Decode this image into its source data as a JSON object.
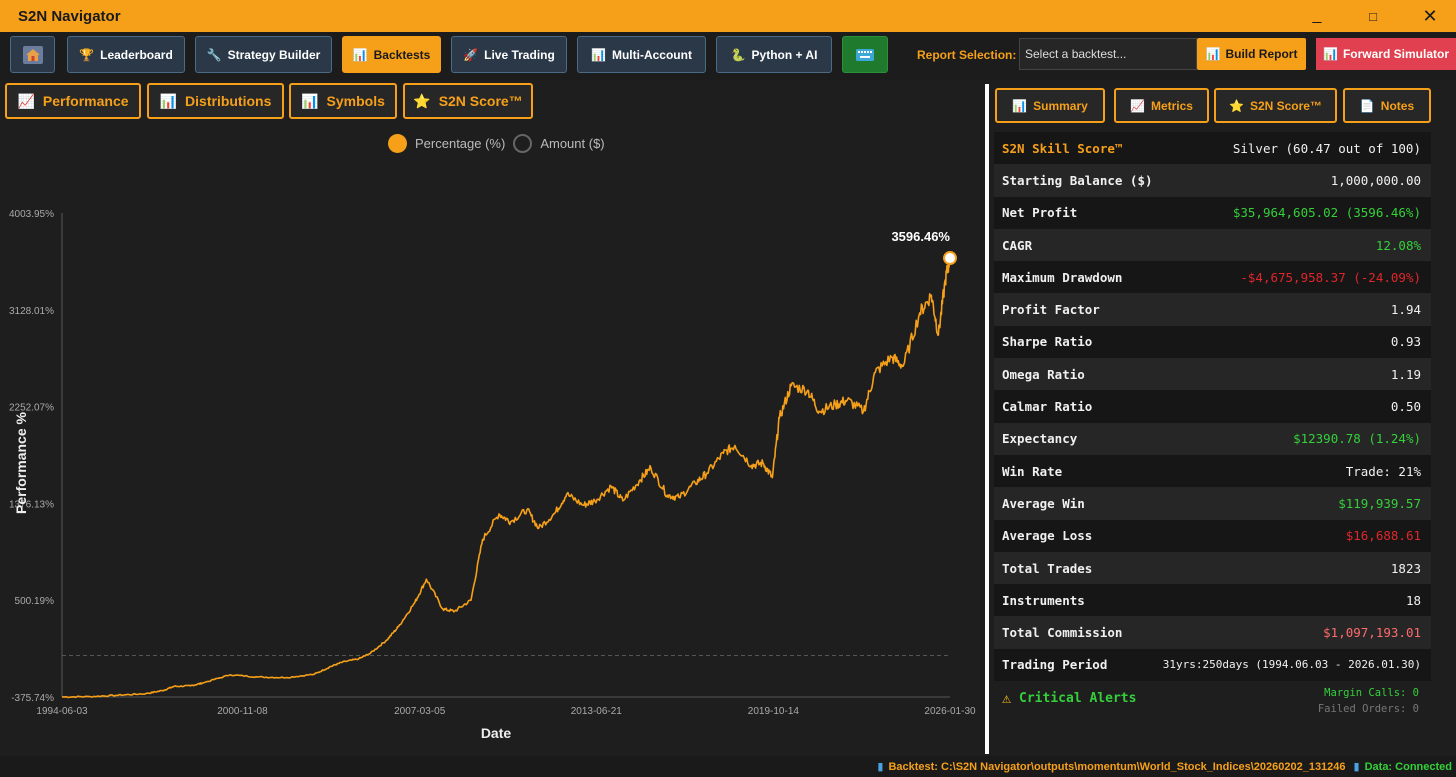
{
  "app": {
    "title": "S2N Navigator"
  },
  "window_controls": {
    "minimize": "_",
    "maximize": "□",
    "close": "✕"
  },
  "toolbar": {
    "home_icon": "home-icon",
    "buttons": [
      {
        "label": "Leaderboard",
        "icon": "🏆"
      },
      {
        "label": "Strategy Builder",
        "icon": "🔧"
      },
      {
        "label": "Backtests",
        "icon": "📊"
      },
      {
        "label": "Live Trading",
        "icon": "🚀"
      },
      {
        "label": "Multi-Account",
        "icon": "📊"
      },
      {
        "label": "Python + AI",
        "icon": "🐍"
      }
    ],
    "report_label": "Report Selection:",
    "report_placeholder": "Select a backtest...",
    "build_report": "Build Report",
    "forward_simulator": "Forward Simulator"
  },
  "left_tabs": [
    {
      "label": "Performance",
      "icon": "📈"
    },
    {
      "label": "Distributions",
      "icon": "📊"
    },
    {
      "label": "Symbols",
      "icon": "📊"
    },
    {
      "label": "S2N Score™",
      "icon": "⭐"
    }
  ],
  "chart": {
    "legend": [
      {
        "label": "Percentage (%)",
        "selected": true
      },
      {
        "label": "Amount ($)",
        "selected": false
      }
    ]
  },
  "chart_data": {
    "type": "line",
    "title": "",
    "xlabel": "Date",
    "ylabel": "Performance %",
    "x_ticks": [
      "1994-06-03",
      "2000-11-08",
      "2007-03-05",
      "2013-06-21",
      "2019-10-14",
      "2026-01-30"
    ],
    "y_ticks": [
      "-375.74%",
      "500.19%",
      "1376.13%",
      "2252.07%",
      "3128.01%",
      "4003.95%"
    ],
    "ylim": [
      -375.74,
      4003.95
    ],
    "xlim": [
      "1994-06-03",
      "2026-01-30"
    ],
    "end_label": "3596.46%",
    "series": [
      {
        "color": "#f6a01a",
        "x": [
          "1994-06-03",
          "1995-06-01",
          "1996-06-01",
          "1997-06-01",
          "1998-01-01",
          "1998-06-01",
          "1999-01-01",
          "1999-06-01",
          "2000-06-01",
          "2001-06-01",
          "2002-06-01",
          "2003-06-01",
          "2004-01-01",
          "2004-06-01",
          "2005-01-01",
          "2005-06-01",
          "2006-01-01",
          "2006-06-01",
          "2007-01-01",
          "2007-06-01",
          "2008-01-01",
          "2008-06-01",
          "2009-01-01",
          "2009-06-01",
          "2010-01-01",
          "2010-06-01",
          "2011-01-01",
          "2011-06-01",
          "2012-01-01",
          "2012-06-01",
          "2013-01-01",
          "2013-06-01",
          "2014-01-01",
          "2014-06-01",
          "2015-01-01",
          "2015-06-01",
          "2016-01-01",
          "2016-06-01",
          "2017-01-01",
          "2017-06-01",
          "2018-01-01",
          "2018-06-01",
          "2019-01-01",
          "2019-06-01",
          "2019-10-01",
          "2020-01-01",
          "2020-06-01",
          "2021-01-01",
          "2021-06-01",
          "2022-01-01",
          "2022-06-01",
          "2023-01-01",
          "2023-06-01",
          "2024-01-01",
          "2024-06-01",
          "2025-01-01",
          "2025-06-01",
          "2025-09-01",
          "2025-12-01",
          "2026-01-30"
        ],
        "y": [
          -375,
          -372,
          -360,
          -345,
          -318,
          -280,
          -275,
          -250,
          -175,
          -195,
          -200,
          -170,
          -100,
          -60,
          -30,
          20,
          140,
          260,
          480,
          690,
          420,
          400,
          500,
          1050,
          1280,
          1210,
          1320,
          1150,
          1290,
          1460,
          1360,
          1400,
          1530,
          1400,
          1580,
          1700,
          1450,
          1430,
          1560,
          1650,
          1830,
          1900,
          1720,
          1740,
          1610,
          2150,
          2440,
          2400,
          2210,
          2270,
          2310,
          2210,
          2560,
          2700,
          2620,
          3100,
          3260,
          2900,
          3400,
          3596.46
        ]
      }
    ]
  },
  "right_tabs": [
    {
      "label": "Summary",
      "icon": "📊"
    },
    {
      "label": "Metrics",
      "icon": "📈"
    },
    {
      "label": "S2N Score™",
      "icon": "⭐"
    },
    {
      "label": "Notes",
      "icon": "📄"
    }
  ],
  "stats": [
    {
      "label": "S2N Skill Score™",
      "value": "Silver (60.47 out of 100)"
    },
    {
      "label": "Starting Balance ($)",
      "value": "1,000,000.00"
    },
    {
      "label": "Net Profit",
      "value": "$35,964,605.02 (3596.46%)"
    },
    {
      "label": "CAGR",
      "value": "12.08%"
    },
    {
      "label": "Maximum Drawdown",
      "value": "-$4,675,958.37 (-24.09%)"
    },
    {
      "label": "Profit Factor",
      "value": "1.94"
    },
    {
      "label": "Sharpe Ratio",
      "value": "0.93"
    },
    {
      "label": "Omega Ratio",
      "value": "1.19"
    },
    {
      "label": "Calmar Ratio",
      "value": "0.50"
    },
    {
      "label": "Expectancy",
      "value": "$12390.78 (1.24%)"
    },
    {
      "label": "Win Rate",
      "value": "Trade: 21%"
    },
    {
      "label": "Average Win",
      "value": "$119,939.57"
    },
    {
      "label": "Average Loss",
      "value": "$16,688.61"
    },
    {
      "label": "Total Trades",
      "value": "1823"
    },
    {
      "label": "Instruments",
      "value": "18"
    },
    {
      "label": "Total Commission",
      "value": "$1,097,193.01"
    },
    {
      "label": "Trading Period",
      "value": "31yrs:250days (1994.06.03 - 2026.01.30)"
    }
  ],
  "alerts": {
    "title": "Critical Alerts",
    "margin_calls": "Margin Calls: 0",
    "failed_orders": "Failed Orders: 0"
  },
  "statusbar": {
    "backtest": "Backtest: C:\\S2N Navigator\\outputs\\momentum\\World_Stock_Indices\\20260202_131246",
    "connection": "Data: Connected"
  }
}
